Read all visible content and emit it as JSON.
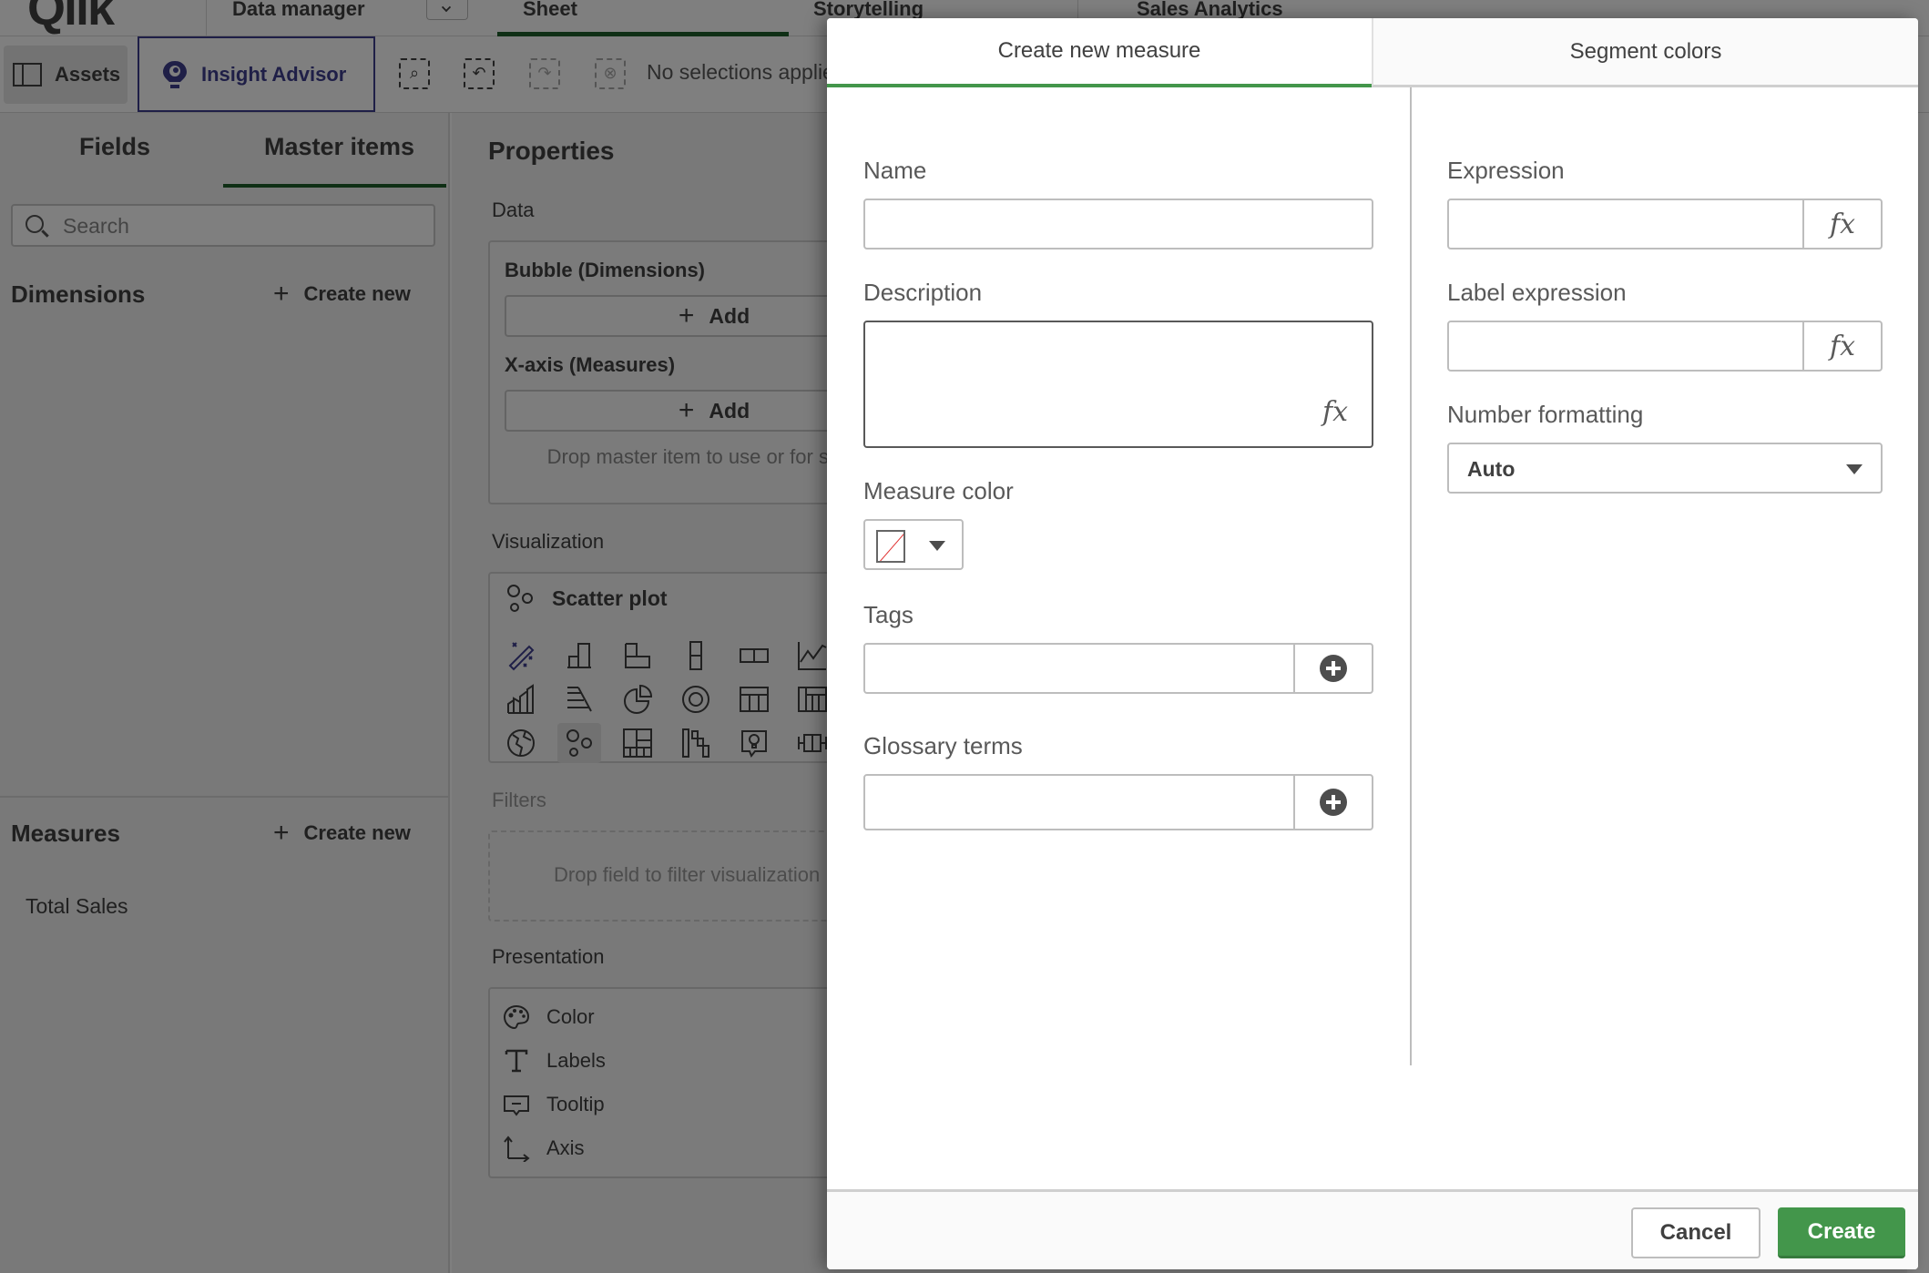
{
  "app": {
    "logo": "Qlik",
    "nav": {
      "data_manager": "Data manager",
      "sheet": "Sheet",
      "storytelling": "Storytelling",
      "app_title": "Sales Analytics"
    },
    "toolbar": {
      "assets": "Assets",
      "insight_advisor": "Insight Advisor",
      "selections_status": "No selections applied"
    },
    "left_panel": {
      "tabs": [
        {
          "label": "Fields",
          "active": false
        },
        {
          "label": "Master items",
          "active": true
        }
      ],
      "search_placeholder": "Search",
      "dimensions": {
        "title": "Dimensions",
        "create_label": "Create new",
        "items": []
      },
      "measures": {
        "title": "Measures",
        "create_label": "Create new",
        "items": [
          "Total Sales"
        ]
      }
    },
    "properties": {
      "title": "Properties",
      "data_section": "Data",
      "bubble_label": "Bubble (Dimensions)",
      "xaxis_label": "X-axis (Measures)",
      "add_label": "Add",
      "drop_hint": "Drop master item to use or for suggestion",
      "visualization_section": "Visualization",
      "current_viz": "Scatter plot",
      "viz_icons": [
        "magic-wand",
        "bar-chart",
        "combo-chart",
        "kpi",
        "text-image",
        "line-chart",
        "mekko-chart",
        "distribution-plot",
        "pie-chart",
        "donut-chart",
        "table",
        "pivot-table",
        "map",
        "scatter-plot",
        "treemap",
        "waterfall",
        "insight",
        "boxplot"
      ],
      "selected_viz": "scatter-plot",
      "filters_section": "Filters",
      "filters_hint": "Drop field to filter visualization",
      "presentation_section": "Presentation",
      "presentation_items": [
        "Color",
        "Labels",
        "Tooltip",
        "Axis"
      ]
    }
  },
  "modal": {
    "tabs": [
      {
        "label": "Create new measure",
        "active": true
      },
      {
        "label": "Segment colors",
        "active": false
      }
    ],
    "fields": {
      "name": {
        "label": "Name",
        "value": ""
      },
      "description": {
        "label": "Description",
        "value": ""
      },
      "measure_color": {
        "label": "Measure color",
        "value": "none"
      },
      "tags": {
        "label": "Tags",
        "value": ""
      },
      "glossary_terms": {
        "label": "Glossary terms",
        "value": ""
      },
      "expression": {
        "label": "Expression",
        "value": ""
      },
      "label_expression": {
        "label": "Label expression",
        "value": ""
      },
      "number_formatting": {
        "label": "Number formatting",
        "value": "Auto"
      }
    },
    "fx_symbol": "fx",
    "buttons": {
      "cancel": "Cancel",
      "create": "Create"
    }
  },
  "colors": {
    "accent_green": "#43964b",
    "dark_green": "#1e5e2a",
    "insight_purple": "#3f3f8f",
    "no_color_slash": "#e03030"
  }
}
